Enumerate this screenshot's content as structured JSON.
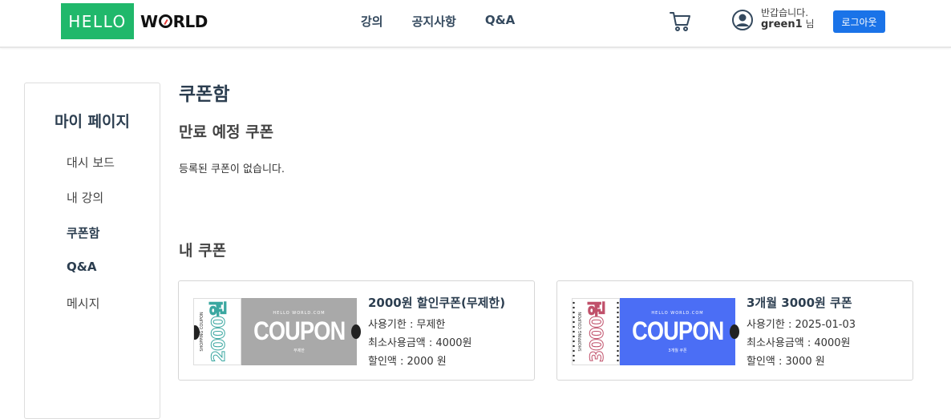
{
  "header": {
    "logo_left": "HELLO",
    "logo_right_w": "W",
    "logo_right_rest": "RLD",
    "nav": [
      "강의",
      "공지사항",
      "Q&A"
    ],
    "greeting": "반갑습니다.",
    "username": "green1",
    "username_suffix": "님",
    "logout_label": "로그아웃",
    "brand_color": "#20b86b",
    "button_color": "#1a73e8"
  },
  "sidebar": {
    "title": "마이 페이지",
    "items": [
      {
        "label": "대시 보드",
        "active": false
      },
      {
        "label": "내 강의",
        "active": false
      },
      {
        "label": "쿠폰함",
        "active": true
      },
      {
        "label": "Q&A",
        "active": true
      },
      {
        "label": "메시지",
        "active": false
      }
    ]
  },
  "main": {
    "page_title": "쿠폰함",
    "expiring_title": "만료 예정 쿠폰",
    "expiring_empty": "등록된 쿠폰이 없습니다.",
    "my_coupons_title": "내 쿠폰",
    "coupons": [
      {
        "name": "2000원 할인쿠폰(무제한)",
        "expiry": "사용기한 : 무제한",
        "min_amount": "최소사용금액 : 4000원",
        "discount": "할인액 : 2000 원",
        "ticket_stub": "2000원",
        "ticket_stub_small": "SHOPPING COUPON",
        "ticket_site": "HELLO WORLD.COM",
        "ticket_word": "COUPON",
        "ticket_sub": "무제한",
        "ticket_color": "#a9a9a9",
        "stub_color": "#3aa7a0"
      },
      {
        "name": "3개월 3000원 쿠폰",
        "expiry": "사용기한 : 2025-01-03",
        "min_amount": "최소사용금액 : 4000원",
        "discount": "할인액 : 3000 원",
        "ticket_stub": "3000원",
        "ticket_stub_small": "SHOPPING COUPON",
        "ticket_site": "HELLO WORLD.COM",
        "ticket_word": "COUPON",
        "ticket_sub": "3개월 쿠폰",
        "ticket_color": "#4b6ef5",
        "stub_color": "#c0506a"
      }
    ]
  }
}
